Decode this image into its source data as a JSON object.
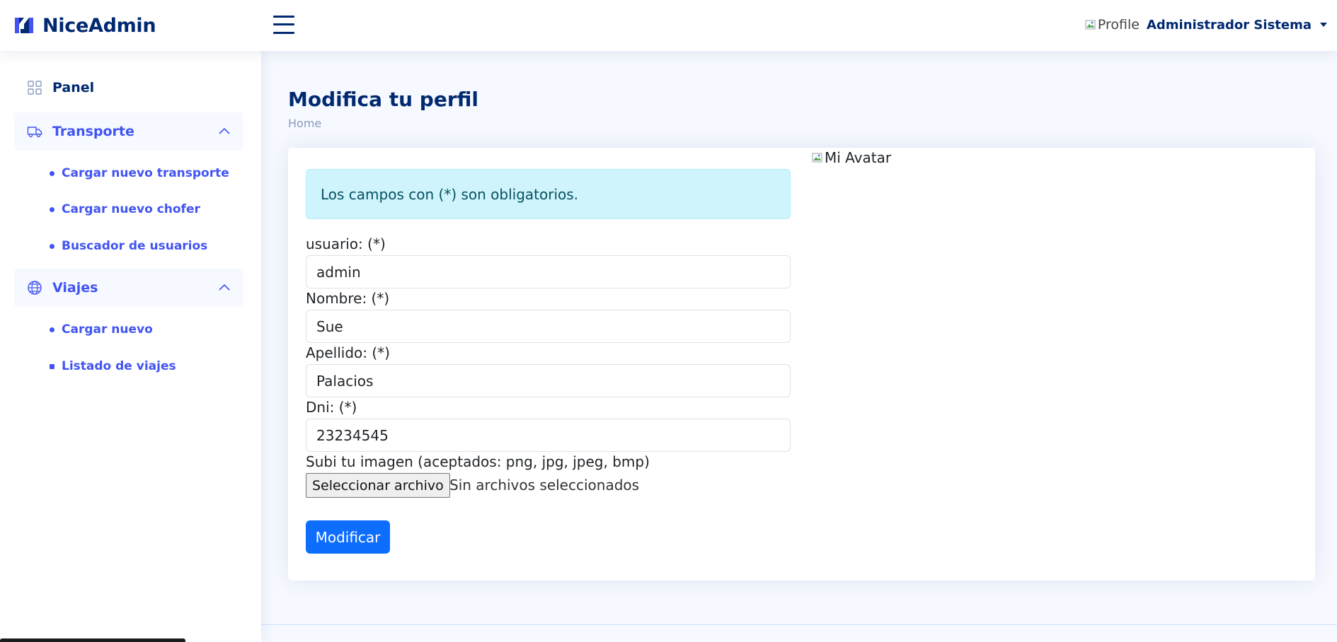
{
  "header": {
    "brand": "NiceAdmin",
    "profile_img_alt": "Profile",
    "user_name": "Administrador Sistema"
  },
  "sidebar": {
    "panel_label": "Panel",
    "groups": [
      {
        "label": "Transporte",
        "icon": "truck-icon",
        "items": [
          "Cargar nuevo transporte",
          "Cargar nuevo chofer",
          "Buscador de usuarios"
        ]
      },
      {
        "label": "Viajes",
        "icon": "globe-icon",
        "items": [
          "Cargar nuevo",
          "Listado de viajes"
        ]
      }
    ]
  },
  "page": {
    "title": "Modifica tu perfil",
    "breadcrumb": "Home"
  },
  "form": {
    "notice": "Los campos con (*) son obligatorios.",
    "fields": [
      {
        "label": "usuario: (*)",
        "value": "admin"
      },
      {
        "label": "Nombre: (*)",
        "value": "Sue"
      },
      {
        "label": "Apellido: (*)",
        "value": "Palacios"
      },
      {
        "label": "Dni: (*)",
        "value": "23234545"
      }
    ],
    "image_label": "Subi tu imagen (aceptados: png, jpg, jpeg, bmp)",
    "file_button": "Seleccionar archivo",
    "file_status": "Sin archivos seleccionados",
    "submit": "Modificar",
    "avatar_alt": "Mi Avatar"
  },
  "colors": {
    "brand": "#012970",
    "accent": "#4154f1",
    "primary_button": "#0d6efd",
    "info_alert_bg": "#cff4fc",
    "background": "#f6f9ff"
  }
}
